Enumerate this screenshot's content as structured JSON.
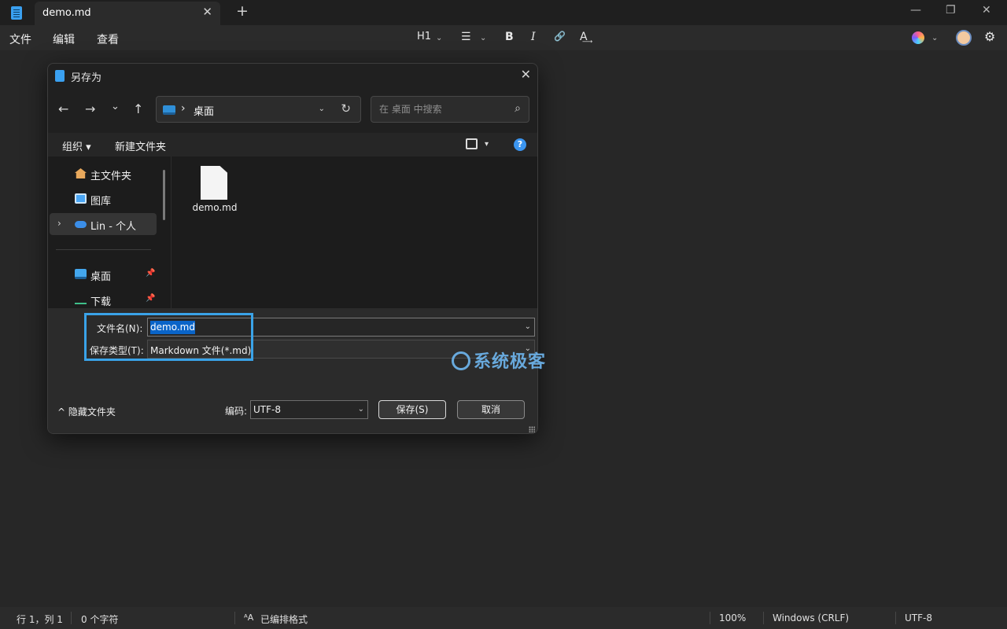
{
  "app": {
    "tab_title": "demo.md",
    "tab_close": "✕",
    "tab_add": "+",
    "window_controls": {
      "minimize": "—",
      "maximize": "❐",
      "close": "✕"
    }
  },
  "menu": {
    "file": "文件",
    "edit": "编辑",
    "view": "查看"
  },
  "toolbar": {
    "heading": "H1",
    "chevron": "⌄",
    "list_icon": "☰",
    "bold": "B",
    "italic": "I",
    "link_icon": "🔗",
    "spellcheck_icon": "A͢",
    "settings_icon": "⚙"
  },
  "dialog": {
    "title": "另存为",
    "close": "✕",
    "nav": {
      "back": "←",
      "forward": "→",
      "recent": "⌄",
      "up": "↑"
    },
    "address": {
      "separator": "›",
      "location": "桌面",
      "dropdown": "⌄",
      "refresh": "↻"
    },
    "search": {
      "placeholder": "在 桌面 中搜索",
      "icon": "⌕"
    },
    "commands": {
      "organize": "组织 ▾",
      "new_folder": "新建文件夹",
      "view_dropdown": "▾",
      "help": "?"
    },
    "nav_pane": [
      {
        "label": "主文件夹",
        "icon": "home-icon",
        "color": "#e8a85c"
      },
      {
        "label": "图库",
        "icon": "gallery-icon",
        "color": "#4aa6f5"
      },
      {
        "label": "Lin - 个人",
        "icon": "onedrive-icon",
        "color": "#3b8ee8"
      },
      {
        "label": "桌面",
        "icon": "desktop-folder-icon",
        "color": "#43a7ee"
      },
      {
        "label": "下载",
        "icon": "download-icon",
        "color": "#3fbf8a"
      }
    ],
    "nav_chevron": "›",
    "pin": "📌",
    "files": [
      {
        "name": "demo.md"
      }
    ],
    "filename_label": "文件名(N):",
    "filename_value": "demo.md",
    "filetype_label": "保存类型(T):",
    "filetype_value": "Markdown 文件(*.md)",
    "hide_folders": "^ 隐藏文件夹",
    "encoding_label": "编码:",
    "encoding_value": "UTF-8",
    "save_label": "保存(S)",
    "cancel_label": "取消",
    "dropdown_chevron": "⌄"
  },
  "watermark": "系统极客",
  "status": {
    "position": "行 1，列 1",
    "chars": "0 个字符",
    "format_icon": "ᴬA",
    "format": "已编排格式",
    "zoom": "100%",
    "line_ending": "Windows (CRLF)",
    "encoding": "UTF-8"
  },
  "colors": {
    "accent": "#3aa3e8",
    "selection": "#0a64c8",
    "background": "#272727"
  }
}
